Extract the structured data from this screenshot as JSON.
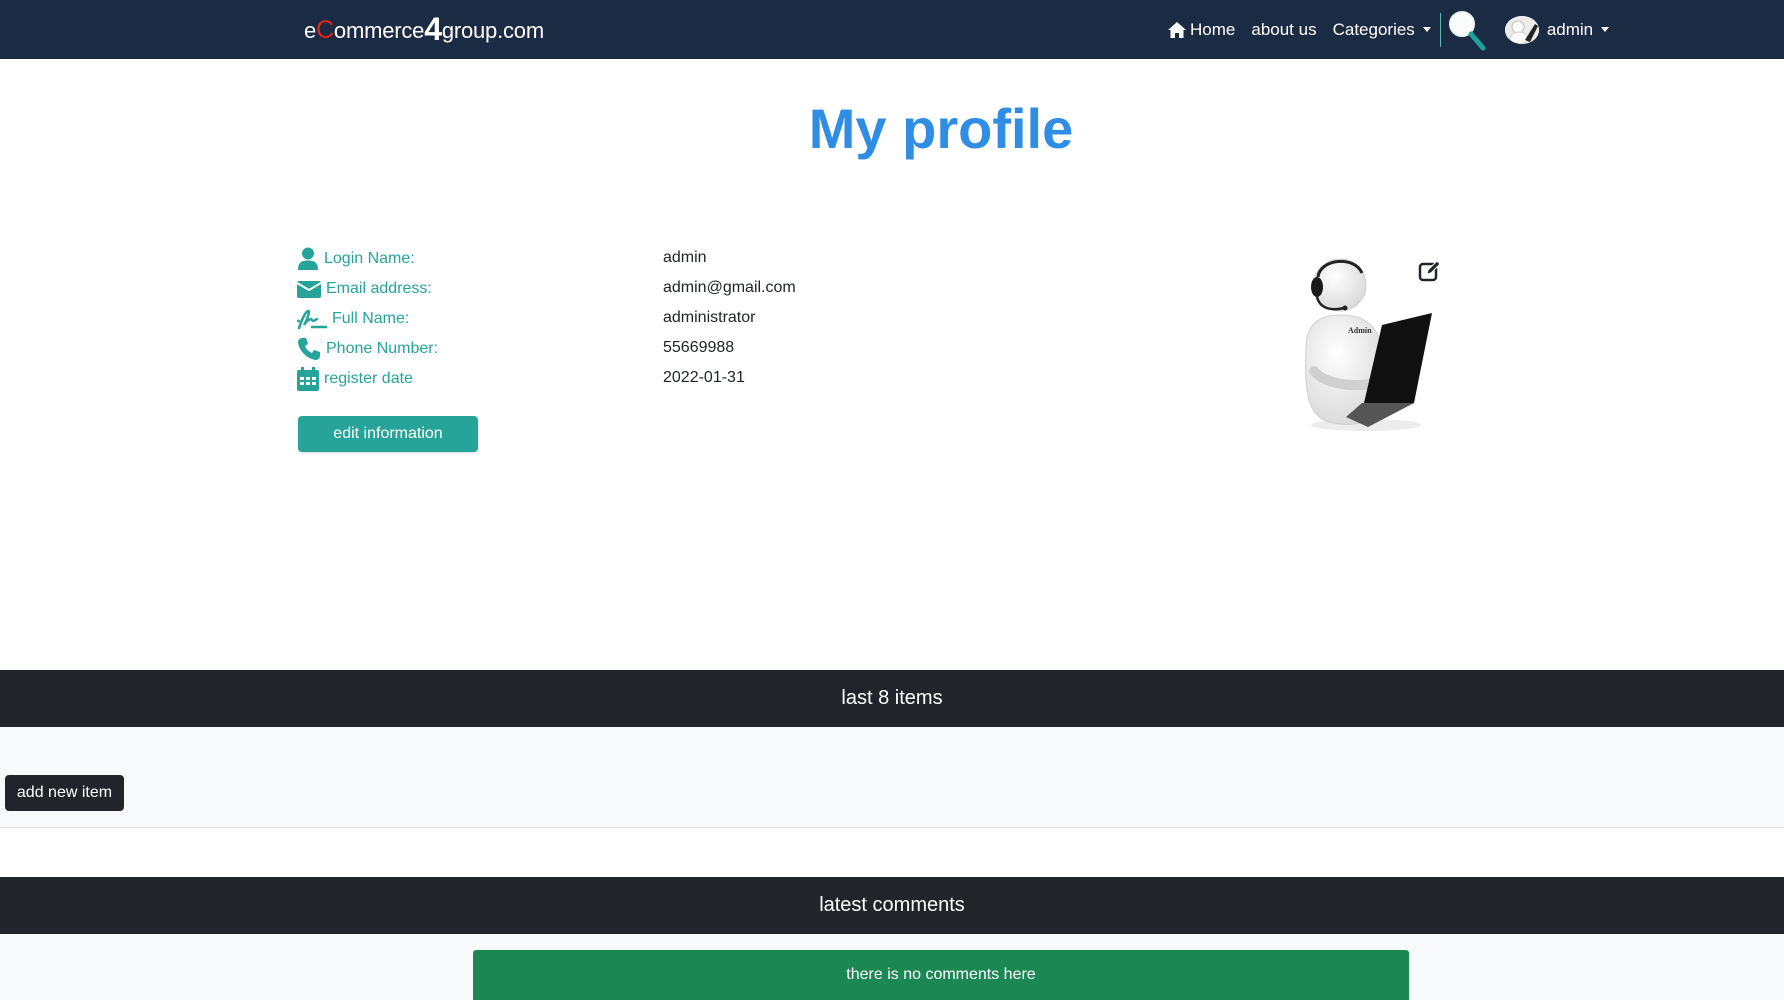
{
  "navbar": {
    "brand": {
      "part1": "e",
      "part2": "C",
      "part3": "ommerce",
      "part4": "4",
      "part5": "group.com"
    },
    "home_label": "Home",
    "about_label": "about us",
    "categories_label": "Categories",
    "user_label": "admin"
  },
  "page": {
    "title": "My profile"
  },
  "profile": {
    "fields": [
      {
        "icon": "user-icon",
        "label": "Login Name:",
        "value": "admin"
      },
      {
        "icon": "envelope-icon",
        "label": "Email address:",
        "value": "admin@gmail.com"
      },
      {
        "icon": "signature-icon",
        "label": "Full Name:",
        "value": "administrator"
      },
      {
        "icon": "phone-icon",
        "label": "Phone Number:",
        "value": "55669988"
      },
      {
        "icon": "calendar-icon",
        "label": "register date",
        "value": "2022-01-31"
      }
    ],
    "edit_button_label": "edit information",
    "image_badge": "Admin"
  },
  "items_section": {
    "title": "last 8 items",
    "add_button_label": "add new item"
  },
  "comments_section": {
    "title": "latest comments",
    "empty_message": "there is no comments here"
  },
  "colors": {
    "navbar": "#1c2b44",
    "title": "#2f8de4",
    "teal": "#26a49a",
    "dark": "#212529",
    "success": "#1b8752"
  }
}
